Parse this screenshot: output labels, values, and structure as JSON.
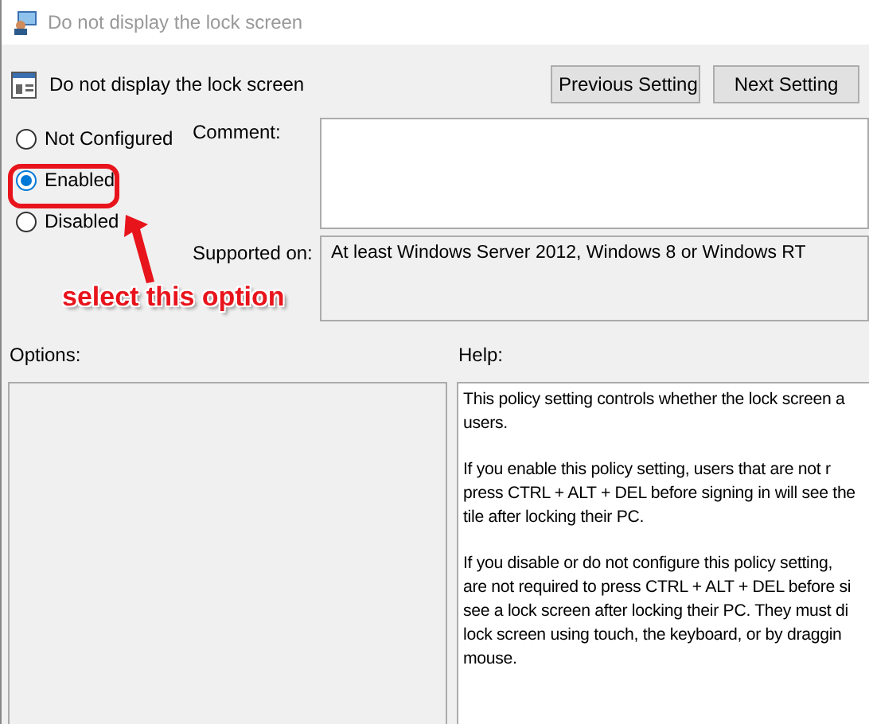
{
  "window": {
    "title": "Do not display the lock screen"
  },
  "header": {
    "title": "Do not display the lock screen",
    "buttons": [
      "Previous Setting",
      "Next Setting"
    ]
  },
  "states": [
    {
      "label": "Not Configured",
      "selected": false
    },
    {
      "label": "Enabled",
      "selected": true
    },
    {
      "label": "Disabled",
      "selected": false
    }
  ],
  "comment": {
    "label": "Comment:"
  },
  "supported_on": {
    "label": "Supported on:",
    "value": "At least Windows Server 2012, Windows 8 or Windows RT"
  },
  "options": {
    "label": "Options:"
  },
  "help": {
    "label": "Help:",
    "paragraphs": [
      [
        "This policy setting controls whether the lock screen a",
        "users."
      ],
      [
        "If you enable this policy setting, users that are not r",
        "press CTRL + ALT + DEL before signing in will see the",
        "tile after  locking their PC."
      ],
      [
        "If you disable or do not configure this policy setting,",
        "are not required to press CTRL + ALT + DEL before si",
        "see a lock screen after locking their PC. They must di",
        "lock screen using touch, the keyboard, or by draggin",
        "mouse."
      ]
    ]
  },
  "annotation": {
    "text": "select this option"
  }
}
